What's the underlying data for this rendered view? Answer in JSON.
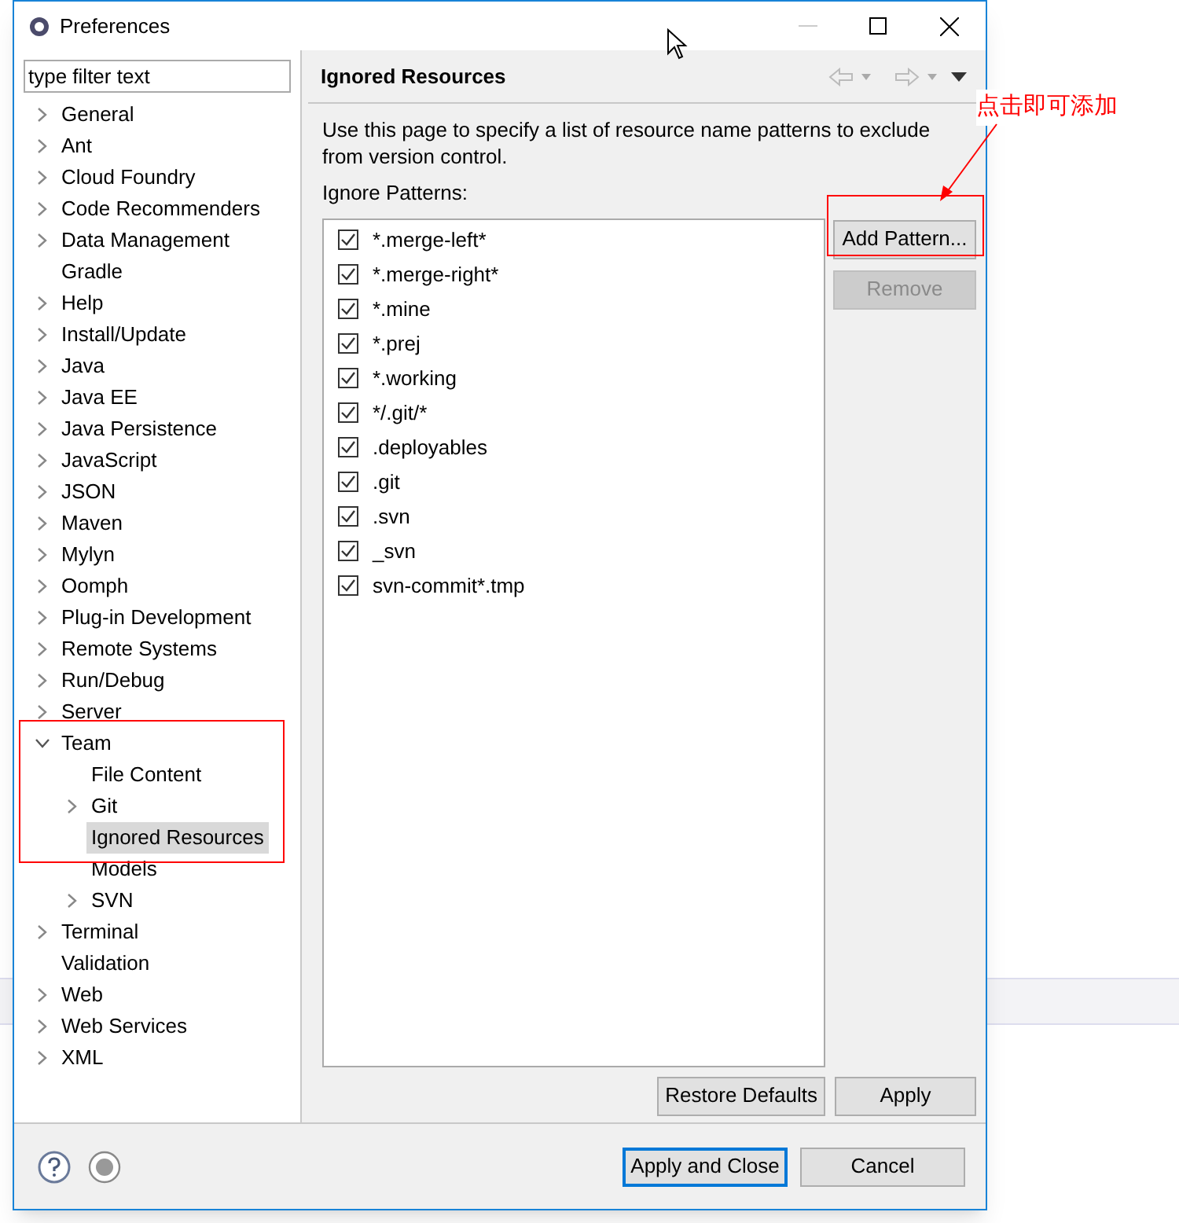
{
  "window": {
    "title": "Preferences"
  },
  "filter": {
    "value": "type filter text"
  },
  "tree": [
    {
      "label": "General",
      "has_children": true,
      "expanded": false,
      "selected": false
    },
    {
      "label": "Ant",
      "has_children": true,
      "expanded": false,
      "selected": false
    },
    {
      "label": "Cloud Foundry",
      "has_children": true,
      "expanded": false,
      "selected": false
    },
    {
      "label": "Code Recommenders",
      "has_children": true,
      "expanded": false,
      "selected": false
    },
    {
      "label": "Data Management",
      "has_children": true,
      "expanded": false,
      "selected": false
    },
    {
      "label": "Gradle",
      "has_children": false,
      "expanded": false,
      "selected": false
    },
    {
      "label": "Help",
      "has_children": true,
      "expanded": false,
      "selected": false
    },
    {
      "label": "Install/Update",
      "has_children": true,
      "expanded": false,
      "selected": false
    },
    {
      "label": "Java",
      "has_children": true,
      "expanded": false,
      "selected": false
    },
    {
      "label": "Java EE",
      "has_children": true,
      "expanded": false,
      "selected": false
    },
    {
      "label": "Java Persistence",
      "has_children": true,
      "expanded": false,
      "selected": false
    },
    {
      "label": "JavaScript",
      "has_children": true,
      "expanded": false,
      "selected": false
    },
    {
      "label": "JSON",
      "has_children": true,
      "expanded": false,
      "selected": false
    },
    {
      "label": "Maven",
      "has_children": true,
      "expanded": false,
      "selected": false
    },
    {
      "label": "Mylyn",
      "has_children": true,
      "expanded": false,
      "selected": false
    },
    {
      "label": "Oomph",
      "has_children": true,
      "expanded": false,
      "selected": false
    },
    {
      "label": "Plug-in Development",
      "has_children": true,
      "expanded": false,
      "selected": false
    },
    {
      "label": "Remote Systems",
      "has_children": true,
      "expanded": false,
      "selected": false
    },
    {
      "label": "Run/Debug",
      "has_children": true,
      "expanded": false,
      "selected": false
    },
    {
      "label": "Server",
      "has_children": true,
      "expanded": false,
      "selected": false
    },
    {
      "label": "Team",
      "has_children": true,
      "expanded": true,
      "selected": false,
      "children": [
        {
          "label": "File Content",
          "has_children": false,
          "expanded": false,
          "selected": false
        },
        {
          "label": "Git",
          "has_children": true,
          "expanded": false,
          "selected": false
        },
        {
          "label": "Ignored Resources",
          "has_children": false,
          "expanded": false,
          "selected": true
        },
        {
          "label": "Models",
          "has_children": false,
          "expanded": false,
          "selected": false
        },
        {
          "label": "SVN",
          "has_children": true,
          "expanded": false,
          "selected": false
        }
      ]
    },
    {
      "label": "Terminal",
      "has_children": true,
      "expanded": false,
      "selected": false
    },
    {
      "label": "Validation",
      "has_children": false,
      "expanded": false,
      "selected": false
    },
    {
      "label": "Web",
      "has_children": true,
      "expanded": false,
      "selected": false
    },
    {
      "label": "Web Services",
      "has_children": true,
      "expanded": false,
      "selected": false
    },
    {
      "label": "XML",
      "has_children": true,
      "expanded": false,
      "selected": false
    }
  ],
  "page": {
    "title": "Ignored Resources",
    "description": "Use this page to specify a list of resource name patterns to exclude from version control.",
    "list_label": "Ignore Patterns:",
    "patterns": [
      {
        "label": "*.merge-left*",
        "checked": true
      },
      {
        "label": "*.merge-right*",
        "checked": true
      },
      {
        "label": "*.mine",
        "checked": true
      },
      {
        "label": "*.prej",
        "checked": true
      },
      {
        "label": "*.working",
        "checked": true
      },
      {
        "label": "*/.git/*",
        "checked": true
      },
      {
        "label": ".deployables",
        "checked": true
      },
      {
        "label": ".git",
        "checked": true
      },
      {
        "label": ".svn",
        "checked": true
      },
      {
        "label": "_svn",
        "checked": true
      },
      {
        "label": "svn-commit*.tmp",
        "checked": true
      }
    ],
    "side_buttons": [
      {
        "label": "Add Pattern...",
        "disabled": false
      },
      {
        "label": "Remove",
        "disabled": true
      }
    ],
    "buttons": [
      "Restore Defaults",
      "Apply"
    ]
  },
  "footer_buttons": [
    {
      "label": "Apply and Close",
      "default": true
    },
    {
      "label": "Cancel",
      "default": false
    }
  ],
  "annotation": {
    "text": "点击即可添加"
  }
}
